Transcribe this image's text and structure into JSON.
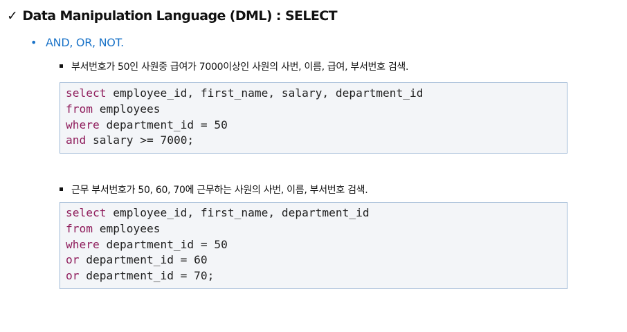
{
  "heading": {
    "check": "✓",
    "text": "Data Manipulation Language (DML) : SELECT"
  },
  "subheading": {
    "bullet": "•",
    "text": "AND, OR, NOT."
  },
  "examples": [
    {
      "description": "부서번호가 50인 사원중 급여가 7000이상인 사원의 사번, 이름, 급여, 부서번호 검색.",
      "code": [
        {
          "kw": "select",
          "rest": " employee_id, first_name, salary, department_id"
        },
        {
          "kw": "from",
          "rest": " employees"
        },
        {
          "kw": "where",
          "rest": " department_id = 50"
        },
        {
          "kw": "and",
          "rest": " salary >= 7000;"
        }
      ]
    },
    {
      "description": "근무 부서번호가 50, 60, 70에 근무하는 사원의 사번, 이름, 부서번호 검색.",
      "code": [
        {
          "kw": "select",
          "rest": " employee_id, first_name, department_id"
        },
        {
          "kw": "from",
          "rest": " employees"
        },
        {
          "kw": "where",
          "rest": " department_id = 50"
        },
        {
          "kw": "or",
          "rest": " department_id = 60"
        },
        {
          "kw": "or",
          "rest": " department_id = 70;"
        }
      ]
    }
  ],
  "colors": {
    "keyword": "#8f1d5c",
    "subheading": "#1a73c8",
    "code_background": "#f3f5f8",
    "code_border": "#9db7d5"
  }
}
